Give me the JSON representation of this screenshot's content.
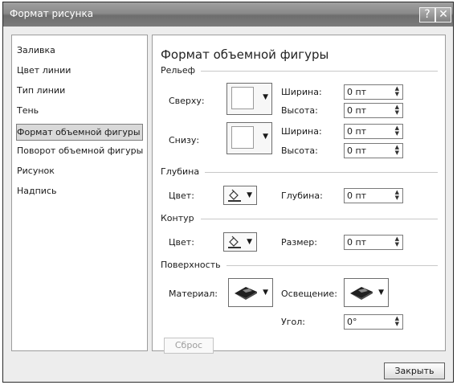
{
  "window": {
    "title": "Формат рисунка",
    "help_glyph": "?",
    "close_glyph": "✕"
  },
  "nav": {
    "items": [
      {
        "label": "Заливка"
      },
      {
        "label": "Цвет линии"
      },
      {
        "label": "Тип линии"
      },
      {
        "label": "Тень"
      },
      {
        "label": "Формат объемной фигуры"
      },
      {
        "label": "Поворот объемной фигуры"
      },
      {
        "label": "Рисунок"
      },
      {
        "label": "Надпись"
      }
    ],
    "selected_index": 4
  },
  "panel": {
    "heading": "Формат объемной фигуры",
    "relief": {
      "section_title": "Рельеф",
      "top": {
        "label": "Сверху:",
        "width_label": "Ширина:",
        "width_value": "0 пт",
        "height_label": "Высота:",
        "height_value": "0 пт"
      },
      "bottom": {
        "label": "Снизу:",
        "width_label": "Ширина:",
        "width_value": "0 пт",
        "height_label": "Высота:",
        "height_value": "0 пт"
      }
    },
    "depth": {
      "section_title": "Глубина",
      "color_label": "Цвет:",
      "depth_label": "Глубина:",
      "depth_value": "0 пт"
    },
    "contour": {
      "section_title": "Контур",
      "color_label": "Цвет:",
      "size_label": "Размер:",
      "size_value": "0 пт"
    },
    "surface": {
      "section_title": "Поверхность",
      "material_label": "Материал:",
      "lighting_label": "Освещение:",
      "angle_label": "Угол:",
      "angle_value": "0°"
    },
    "reset_label": "Сброс"
  },
  "footer": {
    "close_label": "Закрыть"
  },
  "colors": {
    "titlebar": "#8a8a8a",
    "selected_nav": "#d9d9d9",
    "disabled_text": "#9d9d9d"
  },
  "icons": {
    "paint_bucket": "paint-bucket-icon",
    "material": "material-preset-icon",
    "lighting": "lighting-preset-icon"
  }
}
